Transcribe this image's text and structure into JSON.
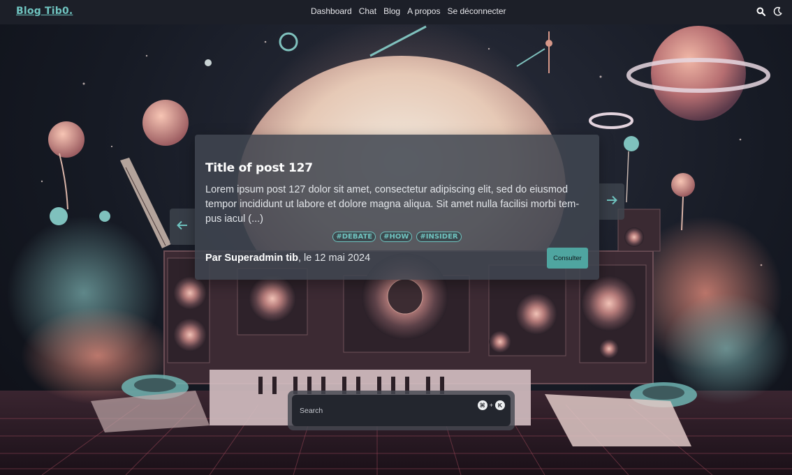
{
  "app": {
    "brand": "Blog Tib0.",
    "accent_color": "#6fc4c0"
  },
  "nav": {
    "items": [
      {
        "label": "Dashboard"
      },
      {
        "label": "Chat"
      },
      {
        "label": "Blog"
      },
      {
        "label": "A propos"
      },
      {
        "label": "Se déconnecter"
      }
    ],
    "icons": [
      "search-icon",
      "moon-icon"
    ]
  },
  "carousel": {
    "post": {
      "title": "Title of post 127",
      "excerpt": "Lorem ipsum post 127 dolor sit amet, consectetur adipiscing elit, sed do eiusmod tempor incididunt ut labore et dolore magna aliqua. Sit amet nulla facilisi morbi tem-pus iacul (...)",
      "tags": [
        "#DEBATE",
        "#HOW",
        "#INSIDER"
      ],
      "author_prefix": "Par ",
      "author": "Superadmin tib",
      "date_text": ", le 12 mai 2024",
      "button_label": "Consulter"
    },
    "prev_icon": "arrow-left-icon",
    "next_icon": "arrow-right-icon"
  },
  "search": {
    "placeholder": "Search",
    "shortcut": {
      "modifier": "⌘",
      "plus": "+",
      "key": "K"
    }
  }
}
